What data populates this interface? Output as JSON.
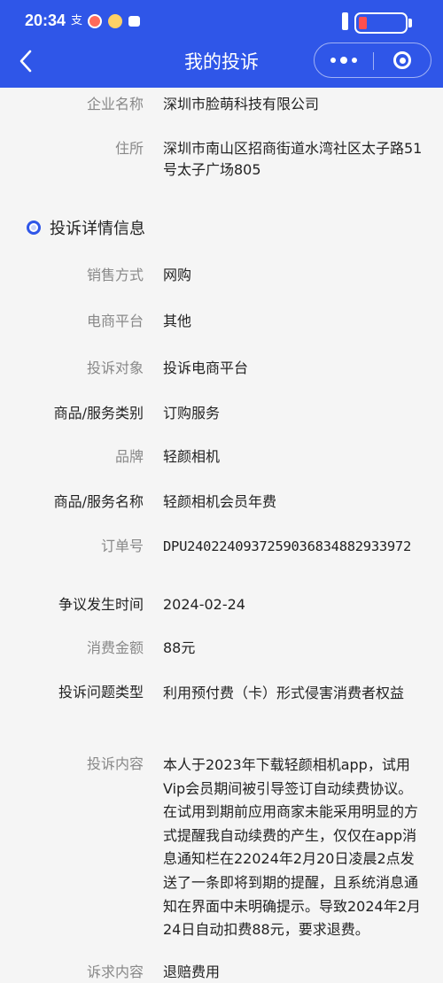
{
  "status_bar": {
    "time": "20:34",
    "icons": [
      "alipay-icon",
      "weibo-icon",
      "game-icon",
      "book-icon"
    ],
    "battery_level": 0.15,
    "battery_color": "#ff4f4f",
    "charging": true
  },
  "header": {
    "title": "我的投诉",
    "background": "#2f56e8",
    "back_icon": "chevron-left-icon",
    "more_icon": "more-dots-icon",
    "close_icon": "target-circle-icon"
  },
  "company": [
    {
      "label": "企业名称",
      "value": "深圳市脸萌科技有限公司"
    },
    {
      "label": "住所",
      "value": "深圳市南山区招商街道水湾社区太子路51号太子广场805"
    }
  ],
  "section": {
    "title": "投诉详情信息",
    "icon": "radio-circle-icon"
  },
  "details": [
    {
      "label": "销售方式",
      "value": "网购"
    },
    {
      "label": "电商平台",
      "value": "其他"
    },
    {
      "label": "投诉对象",
      "value": "投诉电商平台"
    },
    {
      "label": "商品/服务类别",
      "value": "订购服务"
    },
    {
      "label": "品牌",
      "value": "轻颜相机"
    },
    {
      "label": "商品/服务名称",
      "value": "轻颜相机会员年费"
    },
    {
      "label": "订单号",
      "value": "DPU2402240937259036834882933972"
    },
    {
      "label": "争议发生时间",
      "value": "2024-02-24"
    },
    {
      "label": "消费金额",
      "value": "88元"
    },
    {
      "label": "投诉问题类型",
      "value": "利用预付费（卡）形式侵害消费者权益"
    },
    {
      "label": "投诉内容",
      "value": "本人于2023年下载轻颜相机app，试用Vip会员期间被引导签订自动续费协议。在试用到期前应用商家未能采用明显的方式提醒我自动续费的产生，仅仅在app消息通知栏在22024年2月20日凌晨2点发送了一条即将到期的提醒，且系统消息通知在界面中未明确提示。导致2024年2月24日自动扣费88元，要求退费。"
    },
    {
      "label": "诉求内容",
      "value": "退赔费用"
    }
  ]
}
